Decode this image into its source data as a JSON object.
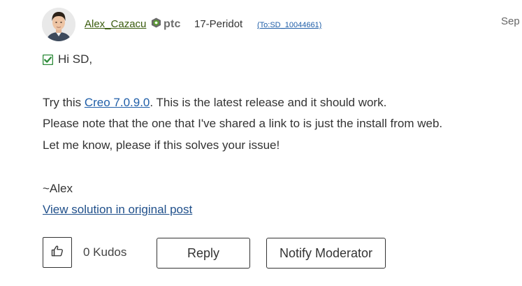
{
  "header": {
    "author_name": "Alex_Cazacu",
    "badge_text": "ptc",
    "rank": "17-Peridot",
    "to_label": "(To:SD_10044661)",
    "date": "Sep"
  },
  "post": {
    "solved_greeting": "Hi SD,",
    "line1_prefix": "Try this ",
    "line1_link": "Creo 7.0.9.0",
    "line1_suffix": ". This is the latest release and it should work.",
    "line2": "Please note that the one that I've shared a link to is just the install from web.",
    "line3": "Let me know, please if this solves your issue!",
    "signature": "~Alex",
    "view_solution_link": "View solution in original post"
  },
  "actions": {
    "kudos_count": "0 Kudos",
    "reply_label": "Reply",
    "notify_label": "Notify Moderator"
  },
  "icons": {
    "avatar": "avatar",
    "badge": "ptc-logo-icon",
    "solved": "checkbox-check-icon",
    "kudo": "thumbs-up-icon"
  },
  "colors": {
    "author_link": "#3a5c0e",
    "link_blue": "#1f5ea8",
    "solved_green": "#2e8b3a",
    "badge_green": "#5a9e2f"
  }
}
